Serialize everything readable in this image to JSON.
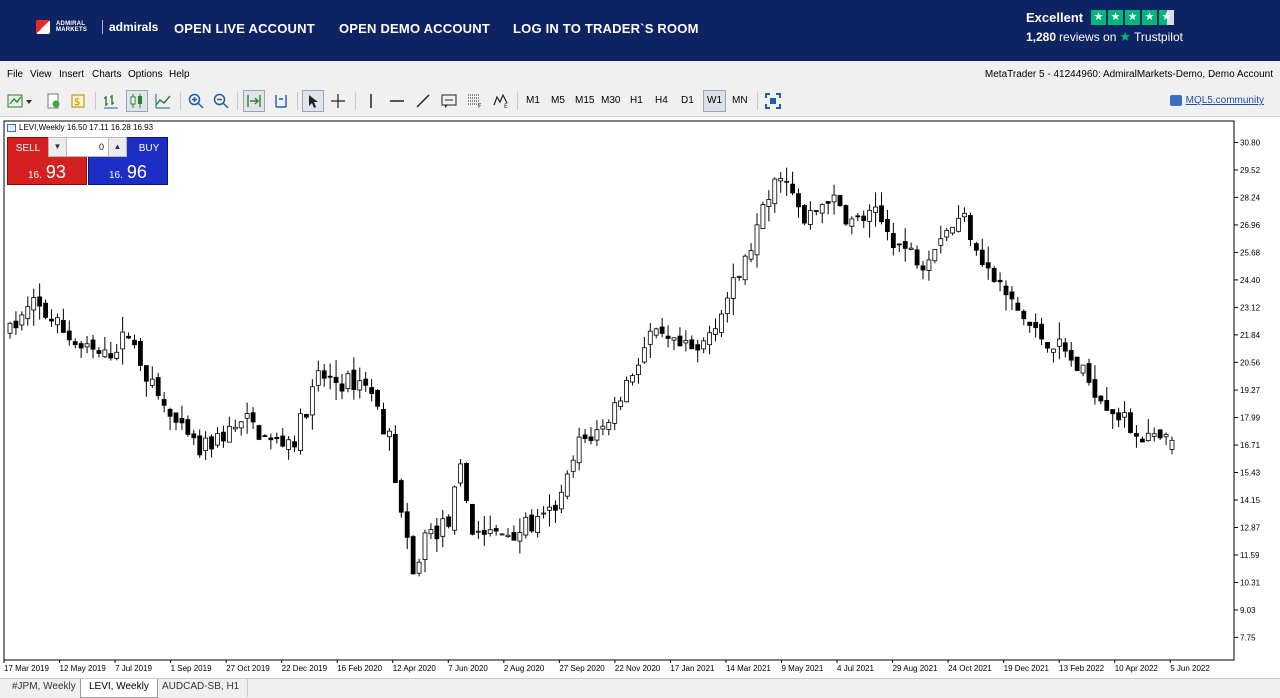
{
  "banner": {
    "logo_small": "ADMIRAL MARKETS",
    "logo_brand": "admirals",
    "nav": [
      "OPEN LIVE ACCOUNT",
      "OPEN DEMO ACCOUNT",
      "LOG IN TO TRADER`S ROOM"
    ],
    "trustpilot": {
      "rating": "Excellent",
      "reviews_count": "1,280",
      "reviews_suffix": "reviews on",
      "brand": "Trustpilot",
      "stars": 4.5
    }
  },
  "menu": {
    "items": [
      "File",
      "View",
      "Insert",
      "Charts",
      "Options",
      "Help"
    ],
    "account": "MetaTrader 5 - 41244960: AdmiralMarkets-Demo, Demo Account"
  },
  "toolbar": {
    "timeframes": [
      "M1",
      "M5",
      "M15",
      "M30",
      "H1",
      "H4",
      "D1",
      "W1",
      "MN"
    ],
    "active_timeframe": "W1",
    "mql_link": "MQL5.community"
  },
  "chart": {
    "header": "LEVI,Weekly  16.50 17.11 16.28 16.93",
    "trade": {
      "sell_label": "SELL",
      "buy_label": "BUY",
      "volume": "0",
      "sell_small": "16.",
      "sell_big": "93",
      "buy_small": "16.",
      "buy_big": "96"
    }
  },
  "tabs": [
    "#JPM, Weekly",
    "LEVI, Weekly",
    "AUDCAD-SB, H1"
  ],
  "active_tab": "LEVI, Weekly",
  "colors": {
    "banner": "#0e2361",
    "sell": "#d42020",
    "buy": "#1d2ec4",
    "trustpilot": "#00b67a"
  },
  "chart_data": {
    "type": "candlestick",
    "symbol": "LEVI",
    "timeframe": "Weekly",
    "y_ticks": [
      30.8,
      29.52,
      28.24,
      26.96,
      25.68,
      24.4,
      23.12,
      21.84,
      20.56,
      19.27,
      17.99,
      16.71,
      15.43,
      14.15,
      12.87,
      11.59,
      10.31,
      9.03,
      7.75
    ],
    "ylim": [
      6.7,
      31.8
    ],
    "x_labels": [
      "17 Mar 2019",
      "12 May 2019",
      "7 Jul 2019",
      "1 Sep 2019",
      "27 Oct 2019",
      "22 Dec 2019",
      "16 Feb 2020",
      "12 Apr 2020",
      "7 Jun 2020",
      "2 Aug 2020",
      "27 Sep 2020",
      "22 Nov 2020",
      "17 Jan 2021",
      "14 Mar 2021",
      "9 May 2021",
      "4 Jul 2021",
      "29 Aug 2021",
      "24 Oct 2021",
      "19 Dec 2021",
      "13 Feb 2022",
      "10 Apr 2022",
      "5 Jun 2022"
    ],
    "close_path": [
      [
        0,
        22.0
      ],
      [
        4,
        23.3
      ],
      [
        8,
        22.3
      ],
      [
        12,
        21.2
      ],
      [
        16,
        20.8
      ],
      [
        20,
        21.9
      ],
      [
        24,
        19.4
      ],
      [
        28,
        17.6
      ],
      [
        32,
        16.4
      ],
      [
        36,
        17.2
      ],
      [
        40,
        17.8
      ],
      [
        44,
        16.8
      ],
      [
        48,
        17.0
      ],
      [
        52,
        19.9
      ],
      [
        56,
        19.6
      ],
      [
        60,
        19.7
      ],
      [
        64,
        17.0
      ],
      [
        66,
        13.5
      ],
      [
        68,
        10.5
      ],
      [
        70,
        12.5
      ],
      [
        72,
        12.7
      ],
      [
        74,
        13.2
      ],
      [
        76,
        15.5
      ],
      [
        78,
        12.8
      ],
      [
        82,
        12.5
      ],
      [
        86,
        12.8
      ],
      [
        90,
        13.2
      ],
      [
        93,
        14.2
      ],
      [
        96,
        16.8
      ],
      [
        100,
        17.5
      ],
      [
        104,
        19.6
      ],
      [
        108,
        21.8
      ],
      [
        112,
        21.3
      ],
      [
        116,
        21.0
      ],
      [
        120,
        23.0
      ],
      [
        124,
        25.2
      ],
      [
        127,
        27.5
      ],
      [
        130,
        29.5
      ],
      [
        134,
        27.0
      ],
      [
        138,
        28.3
      ],
      [
        142,
        27.1
      ],
      [
        146,
        27.4
      ],
      [
        150,
        26.0
      ],
      [
        154,
        25.3
      ],
      [
        157,
        26.6
      ],
      [
        161,
        27.3
      ],
      [
        165,
        24.8
      ],
      [
        169,
        23.3
      ],
      [
        173,
        21.9
      ],
      [
        177,
        21.3
      ],
      [
        181,
        20.0
      ],
      [
        185,
        18.7
      ],
      [
        189,
        17.5
      ],
      [
        193,
        16.9
      ],
      [
        196,
        16.9
      ]
    ]
  }
}
